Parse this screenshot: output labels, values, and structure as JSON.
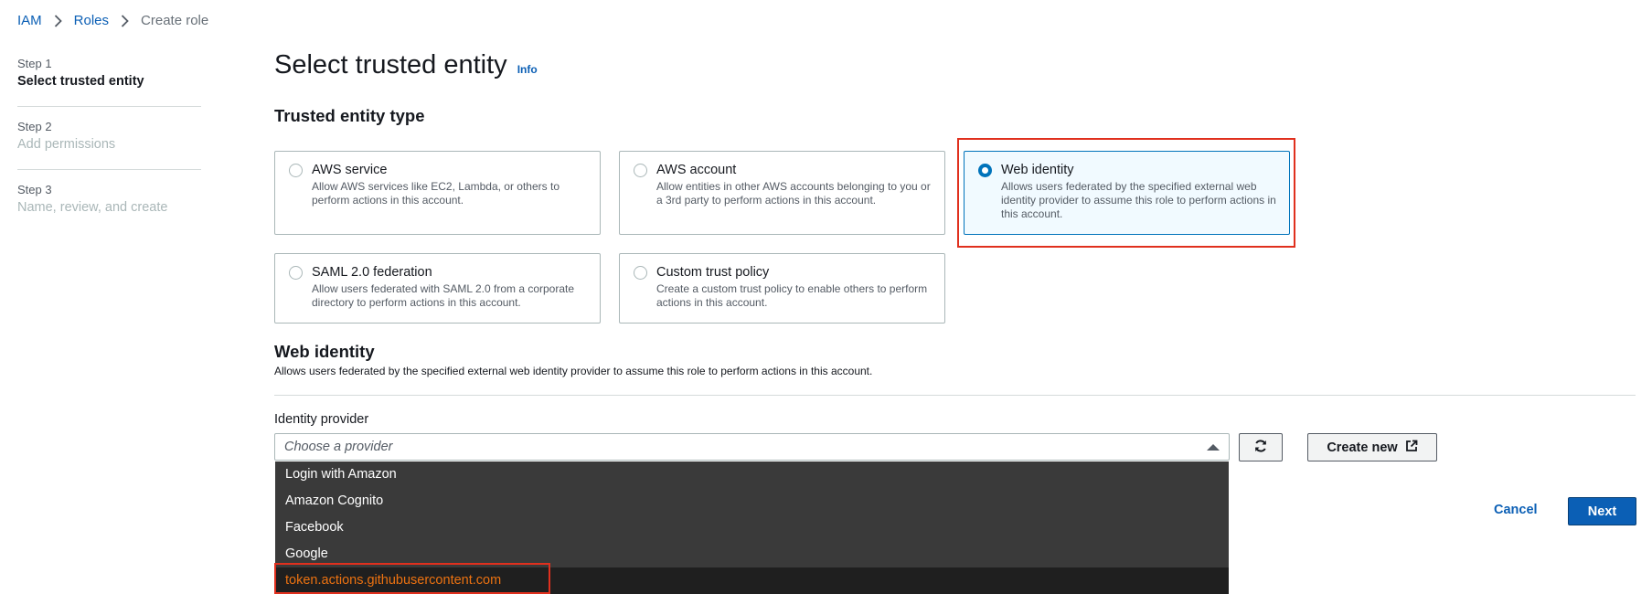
{
  "breadcrumb": {
    "items": [
      "IAM",
      "Roles"
    ],
    "current": "Create role"
  },
  "steps": [
    {
      "num": "Step 1",
      "title": "Select trusted entity"
    },
    {
      "num": "Step 2",
      "title": "Add permissions"
    },
    {
      "num": "Step 3",
      "title": "Name, review, and create"
    }
  ],
  "page": {
    "title": "Select trusted entity",
    "info": "Info"
  },
  "entity_section": {
    "title": "Trusted entity type",
    "selected": "Web identity",
    "options": [
      {
        "title": "AWS service",
        "desc": "Allow AWS services like EC2, Lambda, or others to perform actions in this account."
      },
      {
        "title": "AWS account",
        "desc": "Allow entities in other AWS accounts belonging to you or a 3rd party to perform actions in this account."
      },
      {
        "title": "Web identity",
        "desc": "Allows users federated by the specified external web identity provider to assume this role to perform actions in this account."
      },
      {
        "title": "SAML 2.0 federation",
        "desc": "Allow users federated with SAML 2.0 from a corporate directory to perform actions in this account."
      },
      {
        "title": "Custom trust policy",
        "desc": "Create a custom trust policy to enable others to perform actions in this account."
      }
    ]
  },
  "web_identity": {
    "title": "Web identity",
    "desc": "Allows users federated by the specified external web identity provider to assume this role to perform actions in this account.",
    "provider_label": "Identity provider",
    "provider_placeholder": "Choose a provider",
    "providers": [
      "Login with Amazon",
      "Amazon Cognito",
      "Facebook",
      "Google",
      "token.actions.githubusercontent.com"
    ],
    "highlighted_provider": "token.actions.githubusercontent.com",
    "create_new": "Create new"
  },
  "footer": {
    "cancel": "Cancel",
    "next": "Next"
  },
  "colors": {
    "link": "#0b5fb5",
    "highlight_outline": "#e0301e",
    "dropdown_bg": "#3a3a3a",
    "dropdown_highlight_text": "#ec7211"
  }
}
